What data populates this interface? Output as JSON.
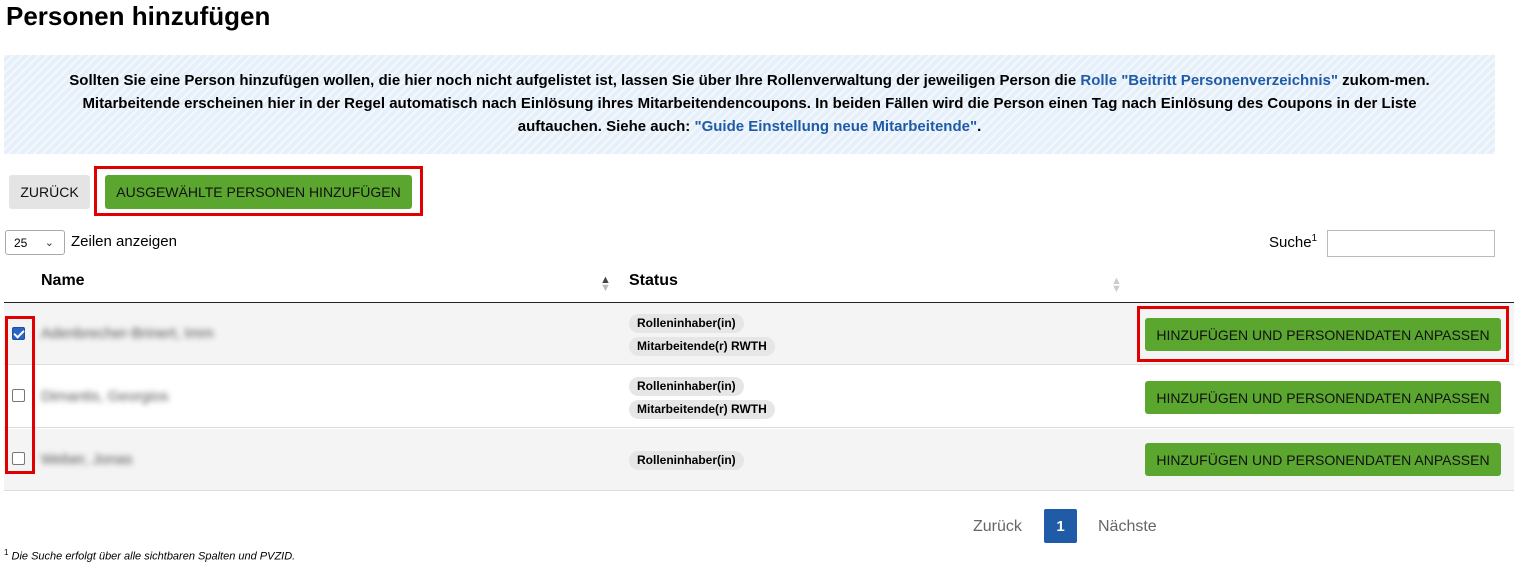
{
  "page": {
    "title": "Personen hinzufügen"
  },
  "info": {
    "text1": "Sollten Sie eine Person hinzufügen wollen, die hier noch nicht aufgelistet ist, lassen Sie über Ihre Rollenverwaltung der jeweiligen Person die ",
    "link1": "Rolle \"Beitritt Personenverzeichnis\"",
    "text2": " zukom-men. Mitarbeitende erscheinen hier in der Regel automatisch nach Einlösung ihres Mitarbeitendencoupons. In beiden Fällen wird die Person einen Tag nach Einlösung des Coupons in der Liste auftauchen. Siehe auch: ",
    "link2": "\"Guide Einstellung neue Mitarbeitende\"",
    "text3": "."
  },
  "toolbar": {
    "back_label": "ZURÜCK",
    "add_selected_label": "AUSGEWÄHLTE PERSONEN HINZUFÜGEN"
  },
  "table_controls": {
    "page_length": "25",
    "length_label": "Zeilen anzeigen",
    "search_label": "Suche",
    "search_sup": "1",
    "search_value": ""
  },
  "table": {
    "columns": [
      "Name",
      "Status"
    ],
    "rows": [
      {
        "checked": true,
        "name": "Adenbrecher-Brinert, Imm",
        "statuses": [
          "Rolleninhaber(in)",
          "Mitarbeitende(r) RWTH"
        ],
        "action": "HINZUFÜGEN UND PERSONENDATEN ANPASSEN"
      },
      {
        "checked": false,
        "name": "Dimantis, Georgios",
        "statuses": [
          "Rolleninhaber(in)",
          "Mitarbeitende(r) RWTH"
        ],
        "action": "HINZUFÜGEN UND PERSONENDATEN ANPASSEN"
      },
      {
        "checked": false,
        "name": "Weber, Jonas",
        "statuses": [
          "Rolleninhaber(in)"
        ],
        "action": "HINZUFÜGEN UND PERSONENDATEN ANPASSEN"
      }
    ]
  },
  "pagination": {
    "prev": "Zurück",
    "current": "1",
    "next": "Nächste"
  },
  "footnote": {
    "sup": "1",
    "text": " Die Suche erfolgt über alle sichtbaren Spalten und PVZID."
  },
  "colors": {
    "accent_green": "#5aa62f",
    "link_blue": "#1f5ba6",
    "highlight_red": "#e10000"
  }
}
